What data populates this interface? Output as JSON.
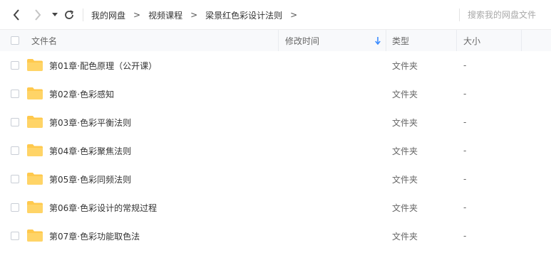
{
  "toolbar": {
    "back_icon": "chevron-left-icon",
    "forward_icon": "chevron-right-icon",
    "dropdown_icon": "caret-down-icon",
    "refresh_icon": "refresh-icon"
  },
  "breadcrumb": {
    "items": [
      "我的网盘",
      "视频课程",
      "梁景红色彩设计法则"
    ],
    "separator": ">"
  },
  "search": {
    "placeholder": "搜索我的网盘文件"
  },
  "table": {
    "columns": {
      "name": "文件名",
      "modified": "修改时间",
      "type": "类型",
      "size": "大小"
    },
    "sort_icon": "sort-down-arrow-icon",
    "rows": [
      {
        "name": "第01章·配色原理（公开课）",
        "modified": "",
        "type": "文件夹",
        "size": "-"
      },
      {
        "name": "第02章·色彩感知",
        "modified": "",
        "type": "文件夹",
        "size": "-"
      },
      {
        "name": "第03章·色彩平衡法则",
        "modified": "",
        "type": "文件夹",
        "size": "-"
      },
      {
        "name": "第04章·色彩聚焦法则",
        "modified": "",
        "type": "文件夹",
        "size": "-"
      },
      {
        "name": "第05章·色彩同频法则",
        "modified": "",
        "type": "文件夹",
        "size": "-"
      },
      {
        "name": "第06章·色彩设计的常规过程",
        "modified": "",
        "type": "文件夹",
        "size": "-"
      },
      {
        "name": "第07章·色彩功能取色法",
        "modified": "",
        "type": "文件夹",
        "size": "-"
      }
    ]
  },
  "colors": {
    "folder": "#ffc94d",
    "sort_arrow": "#3b8cff",
    "header_bg": "#f8f9fb"
  }
}
